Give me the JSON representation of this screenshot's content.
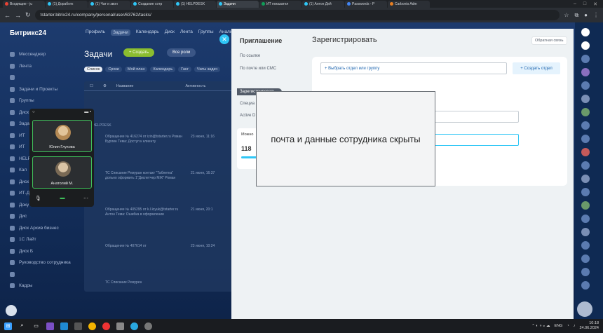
{
  "browser": {
    "tabs": [
      {
        "label": "Входящие - ju",
        "color": "#ea4335"
      },
      {
        "label": "(1) Доработк",
        "color": "#2fc6f6"
      },
      {
        "label": "(1) Чат и звон",
        "color": "#2fc6f6"
      },
      {
        "label": "Создание сотр",
        "color": "#2fc6f6"
      },
      {
        "label": "(1) HELPDESK",
        "color": "#2fc6f6"
      },
      {
        "label": "Задачи",
        "color": "#2fc6f6"
      },
      {
        "label": "ИТ показател",
        "color": "#0f9d58"
      },
      {
        "label": "(1) Антон Дей",
        "color": "#2fc6f6"
      },
      {
        "label": "Passwords - P",
        "color": "#4285f4"
      },
      {
        "label": "Carbonio Adm",
        "color": "#e67e22"
      }
    ],
    "url": "tstarter.bitrix24.ru/company/personal/user/63762/tasks/"
  },
  "app": {
    "brand": "Битрикс24",
    "top_menu": [
      "Профиль",
      "Задачи",
      "Календарь",
      "Диск",
      "Лента",
      "Группы",
      "Аналитик"
    ],
    "left_nav": [
      "Мессенджер",
      "Лента",
      "",
      "Задачи и Проекты",
      "Группы",
      "Диск",
      "Задачи",
      "ИТ",
      "ИТ",
      "HELP",
      "Кал",
      "Диск",
      "ИТ-Д",
      "Доку",
      "Дис",
      "Диск Архив бизнес",
      "1С Лайт",
      "Диск Б",
      "Руководство сотрудника",
      "",
      "Кадры"
    ],
    "tasks_title": "Задачи",
    "create_button": "+ Создать",
    "filter_button": "Все роли",
    "role_chips": [
      "Список",
      "Сроки",
      "Мой план",
      "Календарь",
      "Ганг",
      "Чаты задач"
    ],
    "list_headers": [
      "Название",
      "Активность"
    ],
    "group_label": "HELPDESK",
    "task_rows": [
      {
        "title": "Обращение № 416274 от izin@tstarter.ru Роман Бурлин Тема: Доступ к клиенту",
        "date": "23 июня, 11:16"
      },
      {
        "title": "ТС Списание Ремуран контакт \"Таблетка\" дольно оформить 1\"Диспетчер МЖ\" Роман",
        "date": "21 июня, 16:37"
      },
      {
        "title": "Обращение № 405295 от k.l.loyuk@tstarter.ru Антон Тема: Ошибка в оформлении",
        "date": "21 июня, 20:1"
      },
      {
        "title": "Обращение № 407614 от",
        "date": "23 июня, 10:24"
      },
      {
        "title": "ТС Списание Ремурен",
        "date": ""
      }
    ]
  },
  "invite": {
    "title": "Приглашение",
    "menu": [
      "По ссылке",
      "По почте или СМС",
      "Зарегистрировать",
      "Специа",
      "Active D"
    ],
    "mini_card_title": "Можно",
    "mini_card_count": "118",
    "mini_card_progress": 0.85,
    "register_title": "Зарегистрировать",
    "feedback_label": "Обратная связь",
    "dept_placeholder": "+ Выбрать отдел или группу",
    "dept_button": "+ Создать отдел"
  },
  "call": {
    "participants": [
      "Юлия Глухова",
      "Анатолий М."
    ]
  },
  "privacy_notice": "почта и данные сотрудника скрыты",
  "taskbar": {
    "lang": "ENG",
    "time": "10:18",
    "date": "24.06.2024"
  },
  "colors": {
    "accent": "#2fc6f6",
    "create_green": "#8bbd2f",
    "call_active": "#3fbf5a"
  }
}
